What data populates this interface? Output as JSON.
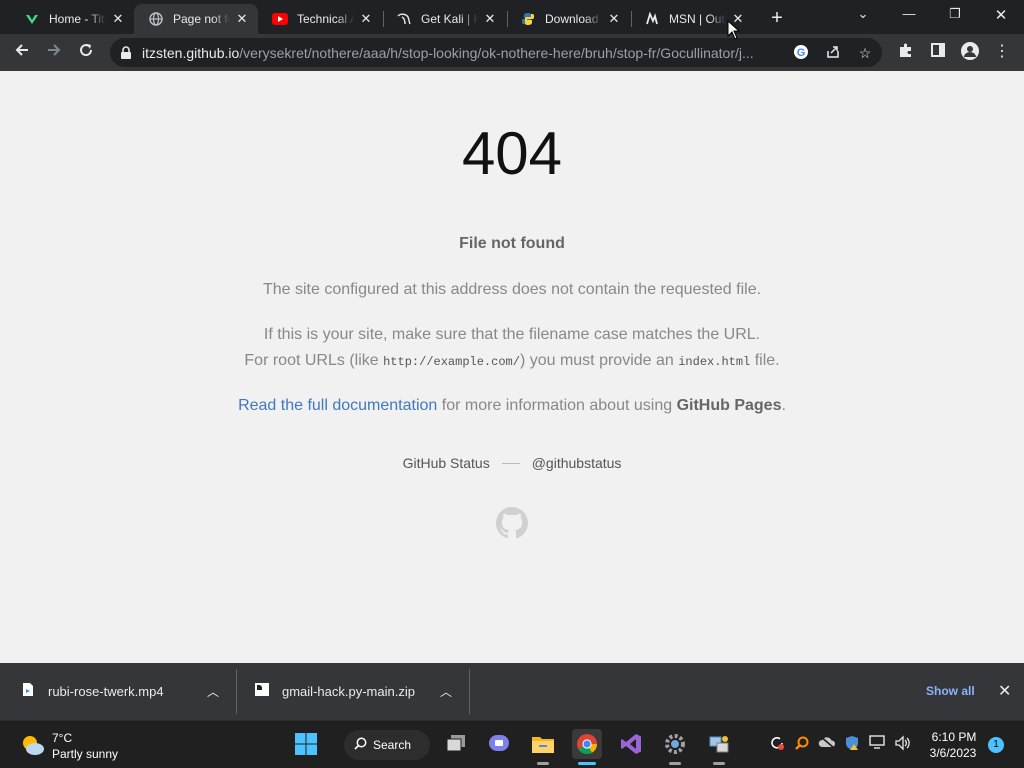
{
  "browser": {
    "tabs": [
      {
        "title": "Home - Tita",
        "icon": "titanic-icon",
        "active": false
      },
      {
        "title": "Page not fo",
        "icon": "globe-icon",
        "active": true
      },
      {
        "title": "Technical A",
        "icon": "youtube-icon",
        "active": false
      },
      {
        "title": "Get Kali | K",
        "icon": "kali-dragon-icon",
        "active": false
      },
      {
        "title": "Download",
        "icon": "python-icon",
        "active": false
      },
      {
        "title": "MSN | Outl",
        "icon": "msn-icon",
        "active": false
      }
    ],
    "url_host": "itzsten.github.io",
    "url_path": "/verysekret/nothere/aaa/h/stop-looking/ok-nothere-here/bruh/stop-fr/Gocullinator/j..."
  },
  "page": {
    "code": "404",
    "subtitle": "File not found",
    "para1": "The site configured at this address does not contain the requested file.",
    "para2_line1": "If this is your site, make sure that the filename case matches the URL.",
    "para2_line2_pre": "For root URLs (like ",
    "para2_code1": "http://example.com/",
    "para2_line2_mid": ") you must provide an ",
    "para2_code2": "index.html",
    "para2_line2_post": " file.",
    "doc_link": "Read the full documentation",
    "doc_mid": " for more information about using ",
    "doc_strong": "GitHub Pages",
    "doc_end": ".",
    "footer_status": "GitHub Status",
    "footer_twitter": "@githubstatus"
  },
  "downloads": {
    "items": [
      {
        "name": "rubi-rose-twerk.mp4",
        "icon": "video-file-icon"
      },
      {
        "name": "gmail-hack.py-main.zip",
        "icon": "zip-file-icon"
      }
    ],
    "show_all": "Show all"
  },
  "taskbar": {
    "weather_temp": "7°C",
    "weather_desc": "Partly sunny",
    "search_label": "Search",
    "time": "6:10 PM",
    "date": "3/6/2023",
    "notification_count": "1"
  },
  "colors": {
    "link": "#4078c0",
    "accent": "#4cc2ff",
    "youtube": "#ff0000"
  }
}
